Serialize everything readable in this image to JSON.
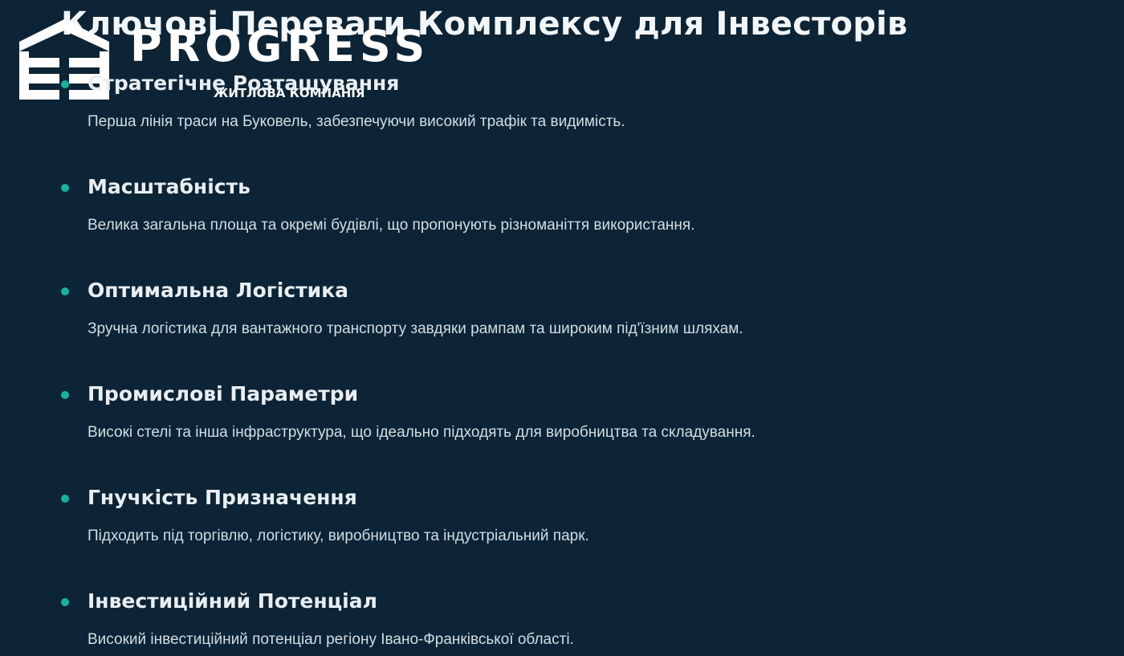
{
  "page": {
    "title": "Ключові Переваги Комплексу для Інвесторів"
  },
  "logo": {
    "icon": "building-logo-icon",
    "wordmark": "PROGRESS",
    "subtitle": "ЖИТЛОВА КОМПАНІЯ"
  },
  "colors": {
    "background": "#0c2435",
    "bullet": "#14b3a0",
    "text": "#ffffff"
  },
  "features": [
    {
      "title": "Стратегічне Розташування",
      "description": "Перша лінія траси на Буковель, забезпечуючи високий трафік та видимість."
    },
    {
      "title": "Масштабність",
      "description": "Велика загальна площа та окремі будівлі, що пропонують різноманіття використання."
    },
    {
      "title": "Оптимальна Логістика",
      "description": "Зручна логістика для вантажного транспорту завдяки рампам та широким під'їзним шляхам."
    },
    {
      "title": "Промислові Параметри",
      "description": "Високі стелі та інша інфраструктура, що ідеально підходять для виробництва та складування."
    },
    {
      "title": "Гнучкість Призначення",
      "description": "Підходить під торгівлю, логістику, виробництво та індустріальний парк."
    },
    {
      "title": "Інвестиційний Потенціал",
      "description": "Високий інвестиційний потенціал регіону Івано-Франківської області."
    }
  ]
}
